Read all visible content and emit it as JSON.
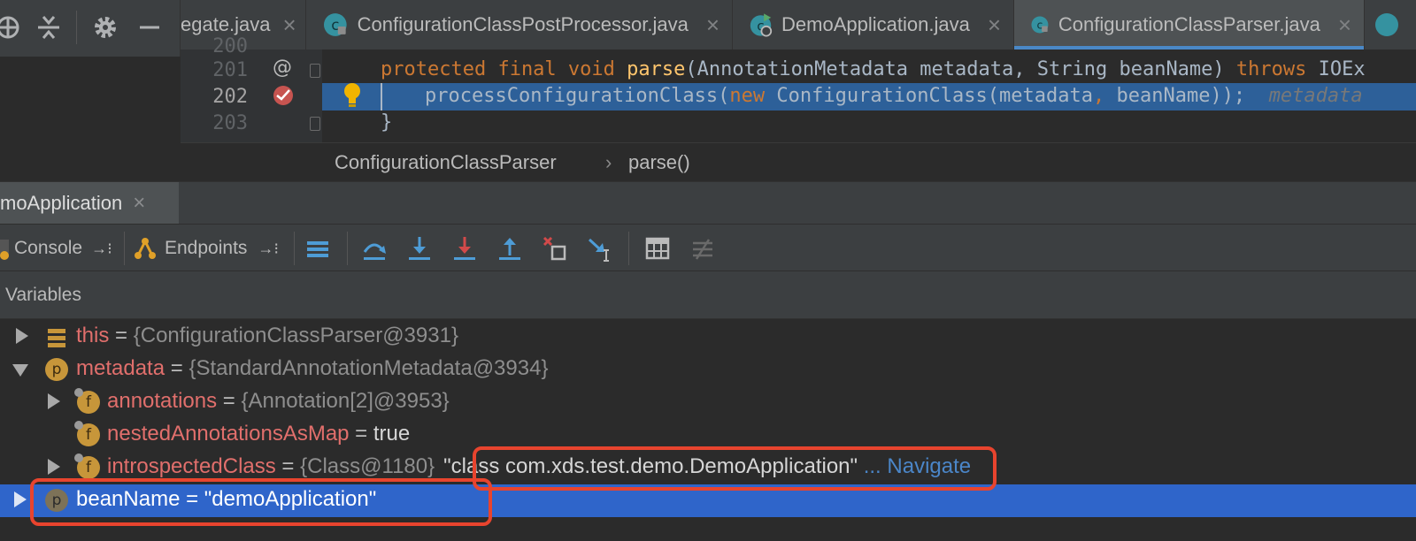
{
  "tabs": [
    {
      "label": "egate.java",
      "icon": "none",
      "active": false
    },
    {
      "label": "ConfigurationClassPostProcessor.java",
      "icon": "class-icon",
      "active": false
    },
    {
      "label": "DemoApplication.java",
      "icon": "run-class-icon",
      "active": false
    },
    {
      "label": "ConfigurationClassParser.java",
      "icon": "class-icon",
      "active": true
    }
  ],
  "editor": {
    "lines": [
      {
        "num": "200"
      },
      {
        "num": "201",
        "code": {
          "kw1": "protected final void ",
          "fn": "parse",
          "rest1": "(AnnotationMetadata metadata, String beanName) ",
          "kw2": "throws ",
          "rest2": "IOEx"
        }
      },
      {
        "num": "202",
        "code": {
          "a": "processConfigurationClass(",
          "kw": "new ",
          "b": "ConfigurationClass(metadata",
          "comma": ", ",
          "c": "beanName));",
          "hint": "metadata"
        }
      },
      {
        "num": "203",
        "code": {
          "brace": "}"
        }
      }
    ]
  },
  "breadcrumb": {
    "class": "ConfigurationClassParser",
    "sep": "›",
    "method": "parse()"
  },
  "debug": {
    "tab_label": "moApplication",
    "console_label": "Console",
    "endpoints_label": "Endpoints",
    "variables_label": "Variables"
  },
  "variables": [
    {
      "name": "this",
      "eq": " = ",
      "value": "{ConfigurationClassParser@3931}",
      "badge": "",
      "icon": "fields-icon",
      "expander": "right",
      "indent": 0
    },
    {
      "name": "metadata",
      "eq": " = ",
      "value": "{StandardAnnotationMetadata@3934}",
      "badge": "p",
      "expander": "down",
      "indent": 0
    },
    {
      "name": "annotations",
      "eq": " = ",
      "value": "{Annotation[2]@3953}",
      "badge": "f",
      "expander": "right",
      "indent": 1
    },
    {
      "name": "nestedAnnotationsAsMap",
      "eq": " = ",
      "value": "true",
      "badge": "f",
      "expander": "none",
      "indent": 1
    },
    {
      "name": "introspectedClass",
      "eq": " = ",
      "value": "{Class@1180}",
      "extra": "\"class com.xds.test.demo.DemoApplication\"",
      "ellipsis": " ... ",
      "link": "Navigate",
      "badge": "f",
      "expander": "right",
      "indent": 1
    },
    {
      "name": "beanName",
      "eq": " = ",
      "value": "\"demoApplication\"",
      "badge": "p",
      "expander": "right",
      "indent": 0,
      "selected": true
    }
  ],
  "colors": {
    "accent": "#4a88c7",
    "selection": "#2f65ca",
    "highlight_box": "#e8442e",
    "var_name": "#e16f6c"
  }
}
